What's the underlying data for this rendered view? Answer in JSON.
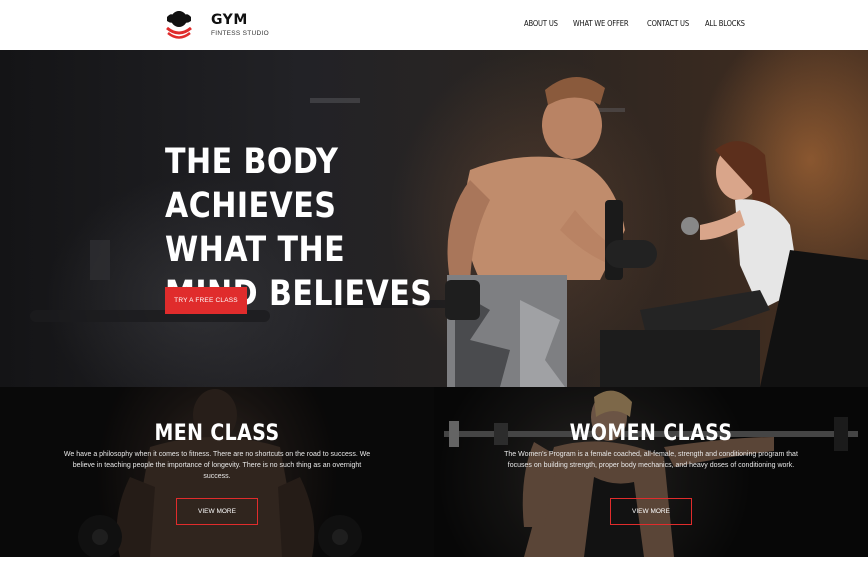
{
  "brand": {
    "name": "GYM",
    "tagline": "FINTESS STUDIO"
  },
  "nav": {
    "items": [
      "ABOUT US",
      "WHAT WE OFFER",
      "CONTACT US",
      "ALL BLOCKS"
    ]
  },
  "hero": {
    "title": "THE BODY ACHIEVES WHAT THE MIND BELIEVES",
    "cta_label": "TRY A FREE CLASS"
  },
  "classes": [
    {
      "title": "MEN CLASS",
      "description": "We have a philosophy when it comes to fitness. There are no shortcuts on the road to success. We believe in teaching people the importance of longevity. There is no such thing as an overnight success.",
      "button_label": "VIEW MORE"
    },
    {
      "title": "WOMEN CLASS",
      "description": "The Women's Program is a female coached, all-female, strength and conditioning program that focuses on building strength, proper body mechanics, and heavy doses of conditioning work.",
      "button_label": "VIEW MORE"
    }
  ],
  "colors": {
    "accent": "#e02c2c",
    "text_dark": "#111111",
    "hero_text": "#ffffff"
  }
}
